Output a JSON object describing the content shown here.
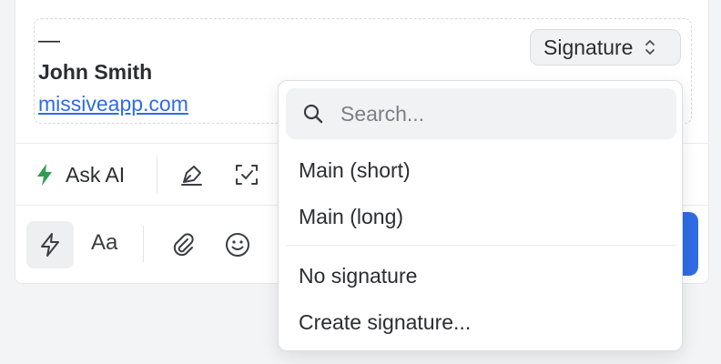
{
  "signature": {
    "dash": "—",
    "name": "John Smith",
    "link": "missiveapp.com",
    "chip_label": "Signature"
  },
  "toolbar": {
    "ask_ai_label": "Ask AI",
    "format_label": "Aa"
  },
  "dropdown": {
    "search_placeholder": "Search...",
    "items": [
      {
        "label": "Main (short)"
      },
      {
        "label": "Main (long)"
      }
    ],
    "actions": [
      {
        "label": "No signature"
      },
      {
        "label": "Create signature..."
      }
    ]
  },
  "colors": {
    "accent": "#2f6ce5",
    "ai_green": "#2e9e4f"
  },
  "icons": [
    "search-icon",
    "chevron-updown-icon",
    "bolt-icon",
    "pen-icon",
    "checkbox-icon",
    "paperclip-icon",
    "emoji-icon"
  ]
}
